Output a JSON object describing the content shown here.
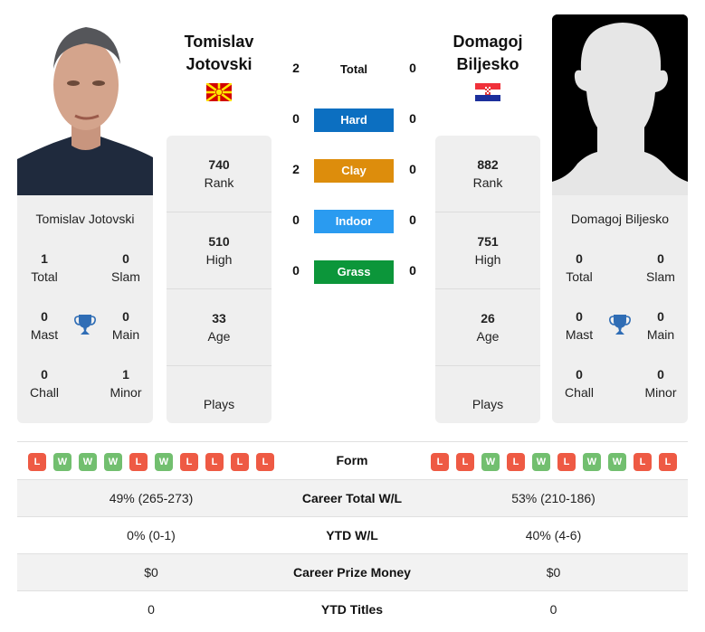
{
  "player_left": {
    "name_line1": "Tomislav",
    "name_line2": "Jotovski",
    "full_name": "Tomislav Jotovski",
    "flag": "north-macedonia-flag",
    "titles": {
      "total": {
        "value": "1",
        "label": "Total"
      },
      "slam": {
        "value": "0",
        "label": "Slam"
      },
      "mast": {
        "value": "0",
        "label": "Mast"
      },
      "main": {
        "value": "0",
        "label": "Main"
      },
      "chall": {
        "value": "0",
        "label": "Chall"
      },
      "minor": {
        "value": "1",
        "label": "Minor"
      }
    },
    "rank": {
      "value": "740",
      "label": "Rank"
    },
    "high": {
      "value": "510",
      "label": "High"
    },
    "age": {
      "value": "33",
      "label": "Age"
    },
    "plays": {
      "value": "",
      "label": "Plays"
    },
    "form": [
      "L",
      "W",
      "W",
      "W",
      "L",
      "W",
      "L",
      "L",
      "L",
      "L"
    ]
  },
  "player_right": {
    "name_line1": "Domagoj",
    "name_line2": "Biljesko",
    "full_name": "Domagoj Biljesko",
    "flag": "croatia-flag",
    "titles": {
      "total": {
        "value": "0",
        "label": "Total"
      },
      "slam": {
        "value": "0",
        "label": "Slam"
      },
      "mast": {
        "value": "0",
        "label": "Mast"
      },
      "main": {
        "value": "0",
        "label": "Main"
      },
      "chall": {
        "value": "0",
        "label": "Chall"
      },
      "minor": {
        "value": "0",
        "label": "Minor"
      }
    },
    "rank": {
      "value": "882",
      "label": "Rank"
    },
    "high": {
      "value": "751",
      "label": "High"
    },
    "age": {
      "value": "26",
      "label": "Age"
    },
    "plays": {
      "value": "",
      "label": "Plays"
    },
    "form": [
      "L",
      "L",
      "W",
      "L",
      "W",
      "L",
      "W",
      "W",
      "L",
      "L"
    ]
  },
  "h2h": {
    "total": {
      "label": "Total",
      "left": "2",
      "right": "0"
    },
    "surfaces": [
      {
        "label": "Hard",
        "left": "0",
        "right": "0",
        "color": "#0c6fc1"
      },
      {
        "label": "Clay",
        "left": "2",
        "right": "0",
        "color": "#dd8d0c"
      },
      {
        "label": "Indoor",
        "left": "0",
        "right": "0",
        "color": "#2a9bf0"
      },
      {
        "label": "Grass",
        "left": "0",
        "right": "0",
        "color": "#0c963a"
      }
    ]
  },
  "comparison": {
    "form_label": "Form",
    "rows": [
      {
        "label": "Career Total W/L",
        "left": "49% (265-273)",
        "right": "53% (210-186)"
      },
      {
        "label": "YTD W/L",
        "left": "0% (0-1)",
        "right": "40% (4-6)"
      },
      {
        "label": "Career Prize Money",
        "left": "$0",
        "right": "$0"
      },
      {
        "label": "YTD Titles",
        "left": "0",
        "right": "0"
      }
    ]
  }
}
